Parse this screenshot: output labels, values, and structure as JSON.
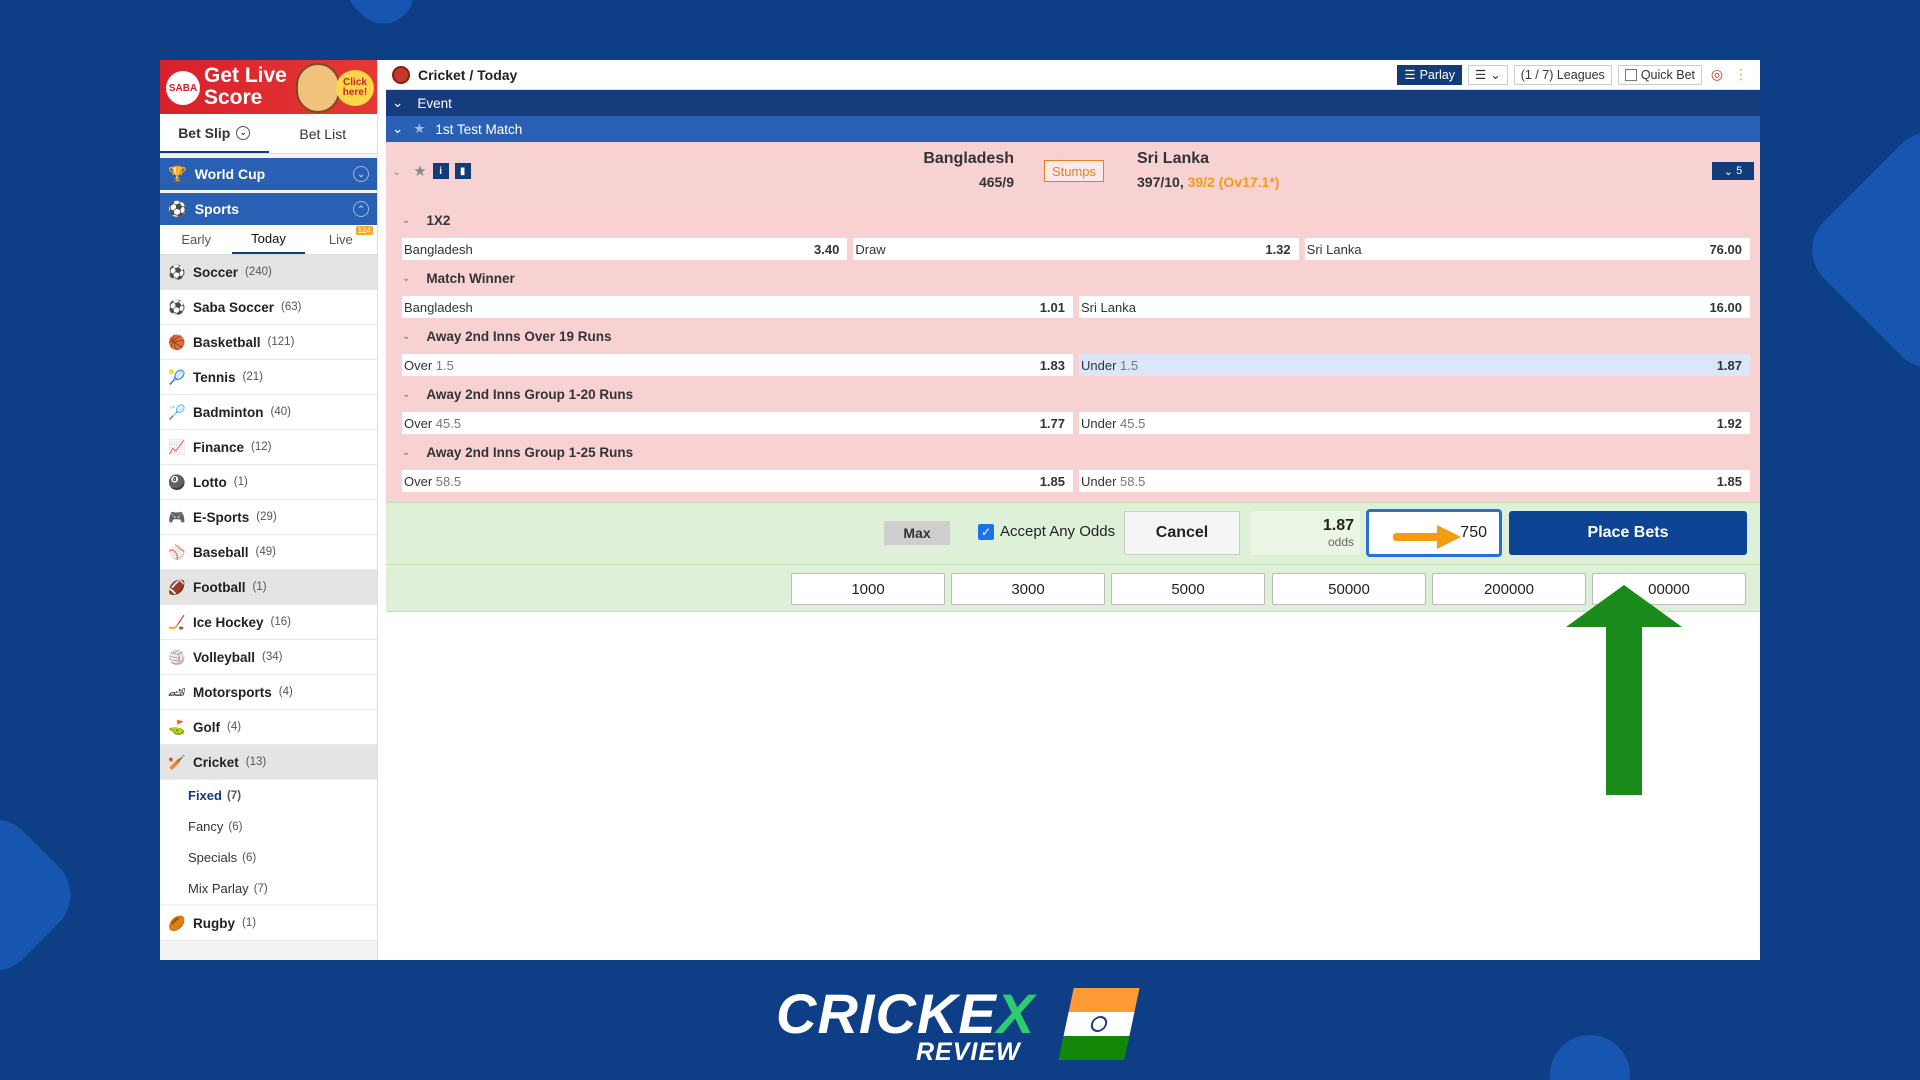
{
  "colors": {
    "background": "#0e3f86",
    "accent": "#2a60b4",
    "place_bets": "#0d4494",
    "pink_rows": "#f8d2d2",
    "green_bar": "#dff0d8",
    "arrow_green": "#1a8a1a",
    "arrow_orange": "#f39c12"
  },
  "banner": {
    "line1": "Get Live",
    "line2": "Score",
    "logo": "SABA",
    "click": "Click here!"
  },
  "slip_tabs": {
    "bet_slip": "Bet Slip",
    "bet_list": "Bet List"
  },
  "sidebar": {
    "world_cup": "World Cup",
    "sports": "Sports",
    "period_tabs": [
      "Early",
      "Today",
      "Live"
    ],
    "live_badge": "124",
    "items": [
      {
        "name": "Soccer",
        "count": "(240)",
        "icon": "⚽"
      },
      {
        "name": "Saba Soccer",
        "count": "(63)",
        "icon": "⚽"
      },
      {
        "name": "Basketball",
        "count": "(121)",
        "icon": "🏀"
      },
      {
        "name": "Tennis",
        "count": "(21)",
        "icon": "🎾"
      },
      {
        "name": "Badminton",
        "count": "(40)",
        "icon": "🏸"
      },
      {
        "name": "Finance",
        "count": "(12)",
        "icon": "📈"
      },
      {
        "name": "Lotto",
        "count": "(1)",
        "icon": "🎱"
      },
      {
        "name": "E-Sports",
        "count": "(29)",
        "icon": "🎮"
      },
      {
        "name": "Baseball",
        "count": "(49)",
        "icon": "⚾"
      },
      {
        "name": "Football",
        "count": "(1)",
        "icon": "🏈"
      },
      {
        "name": "Ice Hockey",
        "count": "(16)",
        "icon": "🏒"
      },
      {
        "name": "Volleyball",
        "count": "(34)",
        "icon": "🏐"
      },
      {
        "name": "Motorsports",
        "count": "(4)",
        "icon": "🏎"
      },
      {
        "name": "Golf",
        "count": "(4)",
        "icon": "⛳"
      },
      {
        "name": "Cricket",
        "count": "(13)",
        "icon": "🏏"
      }
    ],
    "cricket_sub": [
      {
        "name": "Fixed",
        "count": "(7)"
      },
      {
        "name": "Fancy",
        "count": "(6)"
      },
      {
        "name": "Specials",
        "count": "(6)"
      },
      {
        "name": "Mix Parlay",
        "count": "(7)"
      }
    ],
    "rugby": {
      "name": "Rugby",
      "count": "(1)",
      "icon": "🏉"
    }
  },
  "topbar": {
    "title": "Cricket / Today",
    "parlay": "Parlay",
    "leagues": "(1 / 7) Leagues",
    "quick_bet": "Quick Bet"
  },
  "event": {
    "header": "Event",
    "match": "1st Test Match"
  },
  "score": {
    "home_name": "Bangladesh",
    "home_score": "465/9",
    "status": "Stumps",
    "away_name": "Sri Lanka",
    "away_score": "397/10,",
    "away_live": "39/2 (Ov17.1*)",
    "more": "5"
  },
  "markets": {
    "m1": {
      "title": "1X2",
      "odds": [
        {
          "label": "Bangladesh",
          "value": "3.40"
        },
        {
          "label": "Draw",
          "value": "1.32"
        },
        {
          "label": "Sri Lanka",
          "value": "76.00"
        }
      ]
    },
    "m2": {
      "title": "Match Winner",
      "odds": [
        {
          "label": "Bangladesh",
          "value": "1.01"
        },
        {
          "label": "Sri Lanka",
          "value": "16.00"
        }
      ]
    },
    "m3": {
      "title": "Away 2nd Inns Over 19 Runs",
      "odds": [
        {
          "label": "Over",
          "line": "1.5",
          "value": "1.83"
        },
        {
          "label": "Under",
          "line": "1.5",
          "value": "1.87"
        }
      ]
    },
    "m4": {
      "title": "Away 2nd Inns Group 1-20 Runs",
      "odds": [
        {
          "label": "Over",
          "line": "45.5",
          "value": "1.77"
        },
        {
          "label": "Under",
          "line": "45.5",
          "value": "1.92"
        }
      ]
    },
    "m5": {
      "title": "Away 2nd Inns Group 1-25 Runs",
      "odds": [
        {
          "label": "Over",
          "line": "58.5",
          "value": "1.85"
        },
        {
          "label": "Under",
          "line": "58.5",
          "value": "1.85"
        }
      ]
    }
  },
  "betbar": {
    "max": "Max",
    "accept": "Accept Any Odds",
    "cancel": "Cancel",
    "odds_value": "1.87",
    "odds_label": "odds",
    "stake": "750",
    "place": "Place Bets",
    "chips": [
      "1000",
      "3000",
      "5000",
      "50000",
      "200000",
      "00000"
    ]
  },
  "brand": {
    "word_a": "CRICKE",
    "word_x": "X",
    "review": "REVIEW"
  }
}
